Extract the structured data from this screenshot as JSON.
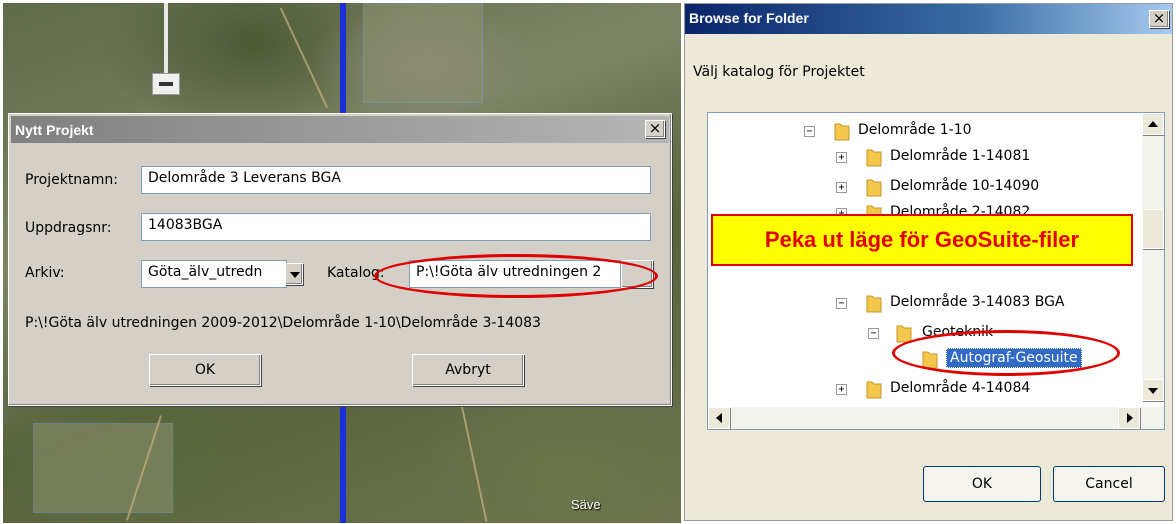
{
  "map": {
    "place_label": "Säve"
  },
  "projekt_dialog": {
    "title": "Nytt Projekt",
    "close_label": "×",
    "projektnamn_label": "Projektnamn:",
    "projektnamn_value": "Delområde 3 Leverans BGA",
    "uppdragsnr_label": "Uppdragsnr:",
    "uppdragsnr_value": "14083BGA",
    "arkiv_label": "Arkiv:",
    "arkiv_value": "Göta_älv_utredn",
    "katalog_label": "Katalog:",
    "katalog_value": "P:\\!Göta älv utredningen 2",
    "path_text": "P:\\!Göta älv utredningen 2009-2012\\Delområde 1-10\\Delområde 3-14083",
    "ok_label": "OK",
    "cancel_label": "Avbryt"
  },
  "browse_dialog": {
    "title": "Browse for Folder",
    "close_label": "×",
    "description": "Välj katalog för Projektet",
    "tree": [
      {
        "label": "Delområde 1-10",
        "expander": "−"
      },
      {
        "label": "Delområde 1-14081",
        "expander": "+"
      },
      {
        "label": "Delområde 10-14090",
        "expander": "+"
      },
      {
        "label": "Delområde 2-14082",
        "expander": "+"
      },
      {
        "label": "Delområde 3-14083 BGA",
        "expander": "−"
      },
      {
        "label": "Geoteknik",
        "expander": "−"
      },
      {
        "label": "Autograf-Geosuite",
        "expander": ""
      },
      {
        "label": "Delområde 4-14084",
        "expander": "+"
      }
    ],
    "ok_label": "OK",
    "cancel_label": "Cancel"
  },
  "annotation": {
    "callout_text": "Peka ut läge för GeoSuite-filer",
    "accent_color": "#e00000",
    "callout_bg": "#ffff00"
  }
}
